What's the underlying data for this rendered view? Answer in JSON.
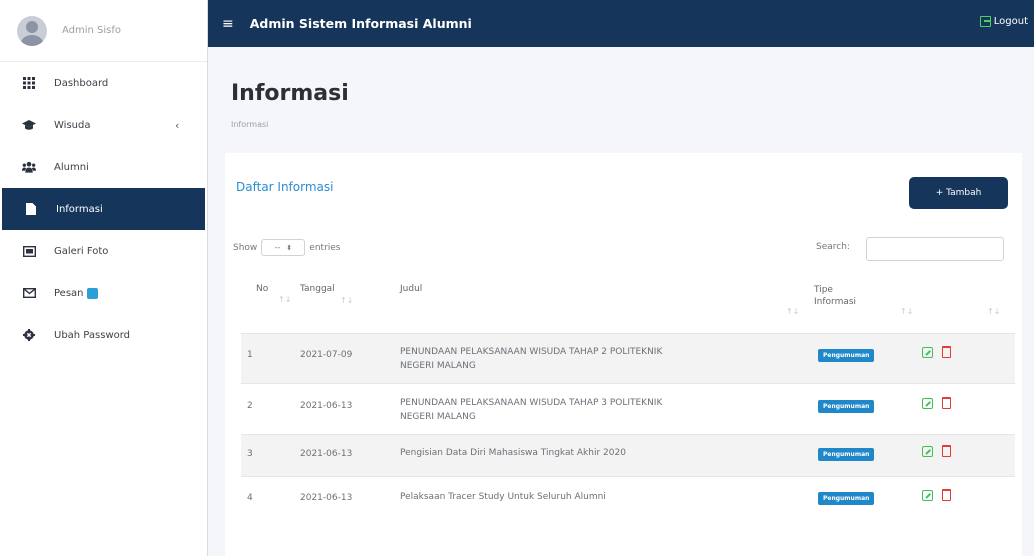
{
  "sidebar": {
    "user_name": "Admin Sisfo",
    "items": [
      {
        "label": "Dashboard",
        "icon": "grid-icon"
      },
      {
        "label": "Wisuda",
        "icon": "graduation-cap-icon"
      },
      {
        "label": "Alumni",
        "icon": "users-icon"
      },
      {
        "label": "Informasi",
        "icon": "file-icon"
      },
      {
        "label": "Galeri Foto",
        "icon": "image-icon"
      },
      {
        "label": "Pesan",
        "icon": "envelope-icon"
      },
      {
        "label": "Ubah Password",
        "icon": "gear-icon"
      }
    ],
    "active": "Informasi",
    "wisuda_chevron": "‹"
  },
  "topbar": {
    "menu_icon": "≡",
    "title": "Admin Sistem Informasi Alumni",
    "logout_label": "Logout"
  },
  "page": {
    "title": "Informasi",
    "breadcrumb": "Informasi"
  },
  "card": {
    "title": "Daftar Informasi",
    "add_button": "+ Tambah",
    "show_label": "Show",
    "entries_value": "--",
    "entries_label": "entries",
    "search_label": "Search:"
  },
  "table": {
    "headers": {
      "no": "No",
      "tanggal": "Tanggal",
      "judul": "Judul",
      "tipe_line1": "Tipe",
      "tipe_line2": "Informasi"
    },
    "rows": [
      {
        "no": "1",
        "tanggal": "2021-07-09",
        "judul_line1": "PENUNDAAN PELAKSANAAN WISUDA TAHAP 2 POLITEKNIK",
        "judul_line2": "NEGERI MALANG",
        "tipe": "Pengumuman"
      },
      {
        "no": "2",
        "tanggal": "2021-06-13",
        "judul_line1": "PENUNDAAN PELAKSANAAN WISUDA TAHAP 3 POLITEKNIK",
        "judul_line2": "NEGERI MALANG",
        "tipe": "Pengumuman"
      },
      {
        "no": "3",
        "tanggal": "2021-06-13",
        "judul_line1": "Pengisian Data Diri Mahasiswa Tingkat Akhir 2020",
        "judul_line2": "",
        "tipe": "Pengumuman"
      },
      {
        "no": "4",
        "tanggal": "2021-06-13",
        "judul_line1": "Pelaksaan Tracer Study Untuk Seluruh Alumni",
        "judul_line2": "",
        "tipe": "Pengumuman"
      }
    ]
  },
  "colors": {
    "primary": "#16355a",
    "accent_link": "#2b8ed0",
    "badge": "#2088c8",
    "edit": "#3fbf5a",
    "delete": "#e53935"
  }
}
